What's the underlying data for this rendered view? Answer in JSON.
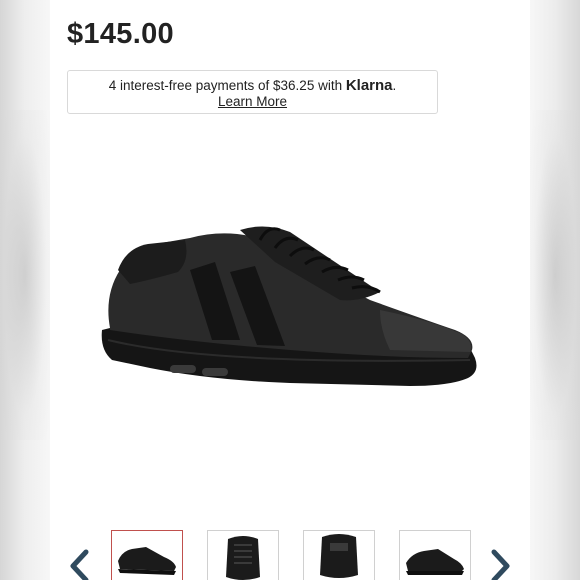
{
  "product": {
    "price": "$145.00"
  },
  "klarna": {
    "text_before": "4 interest-free payments of $36.25 with ",
    "brand": "Klarna",
    "text_after": ".",
    "learn_more": "Learn More"
  },
  "gallery": {
    "main_image_icon": "black-sneaker-side-view",
    "thumbnails": [
      {
        "icon": "sneaker-side-view",
        "selected": true
      },
      {
        "icon": "sneaker-top-view",
        "selected": false
      },
      {
        "icon": "sneaker-back-view",
        "selected": false
      },
      {
        "icon": "sneaker-side-view-alt",
        "selected": false
      }
    ],
    "prev_icon": "chevron-left-icon",
    "next_icon": "chevron-right-icon"
  },
  "colors": {
    "accent_selected_border": "#c0504d",
    "arrow_color": "#2f4a5e",
    "shoe_color": "#1b1b1b"
  }
}
